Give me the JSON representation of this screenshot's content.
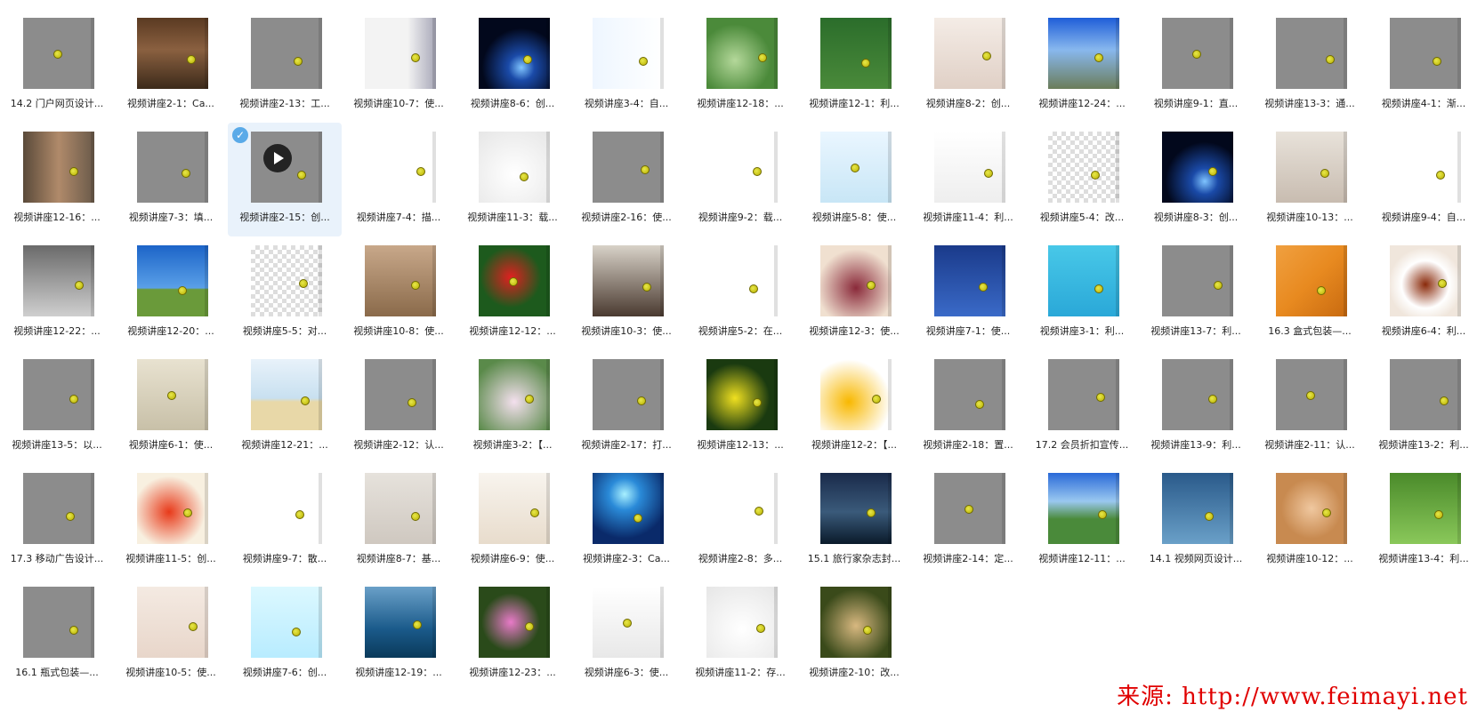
{
  "thumbnails": [
    {
      "label": "14.2 门户网页设计...",
      "bg": "#8c8c8c",
      "icon": "egg-logo-icon"
    },
    {
      "label": "视频讲座2-1：Ca...",
      "bg": "linear-gradient(#5a3a22,#8a6040 45%,#3c2a1a)",
      "icon": "ruined-room-photo-icon"
    },
    {
      "label": "视频讲座2-13：工...",
      "bg": "#8c8c8c",
      "icon": "placeholder-icon"
    },
    {
      "label": "视频讲座10-7：使...",
      "bg": "linear-gradient(90deg,#f3f3f3 60%,#a8a8b8)",
      "icon": "woman-white-shirt-photo-icon"
    },
    {
      "label": "视频讲座8-6：创...",
      "bg": "radial-gradient(circle at 60% 70%,#7fc4ff 0,#1a4aa8 20%,#02081c 60%)",
      "icon": "planet-horizon-photo-icon"
    },
    {
      "label": "视频讲座3-4：自...",
      "bg": "linear-gradient(90deg,#eef6ff,#ffffff)",
      "icon": "cartoon-camel-icon"
    },
    {
      "label": "视频讲座12-18：...",
      "bg": "radial-gradient(circle at 40% 60%,#b4d89a,#4b8a3a 60%)",
      "icon": "leaf-waterdrop-photo-icon"
    },
    {
      "label": "视频讲座12-1：利...",
      "bg": "linear-gradient(#2b6d2b,#4a8a3a)",
      "icon": "tulips-photo-icon"
    },
    {
      "label": "视频讲座8-2：创...",
      "bg": "linear-gradient(#f4ece6,#e0d0c6)",
      "icon": "cat-pillow-photo-icon"
    },
    {
      "label": "视频讲座12-24：...",
      "bg": "linear-gradient(#1f5ed8,#88b8ee 45%,#6b7d5a)",
      "icon": "sky-landscape-photo-icon"
    },
    {
      "label": "视频讲座9-1：直...",
      "bg": "#8c8c8c",
      "icon": "placeholder-icon"
    },
    {
      "label": "视频讲座13-3：通...",
      "bg": "#8c8c8c",
      "icon": "placeholder-icon"
    },
    {
      "label": "视频讲座4-1：渐...",
      "bg": "#8c8c8c",
      "icon": "placeholder-icon"
    },
    {
      "label": "视频讲座12-16：...",
      "bg": "linear-gradient(90deg,#5a4a3a,#b08a6a 50%,#6a5a4a)",
      "icon": "warrior-woman-photo-icon"
    },
    {
      "label": "视频讲座7-3：填...",
      "bg": "#8c8c8c",
      "icon": "placeholder-icon"
    },
    {
      "label": "视频讲座2-15：创...",
      "bg": "#8c8c8c",
      "icon": "video-placeholder-icon"
    },
    {
      "label": "视频讲座7-4：描...",
      "bg": "#ffffff",
      "icon": "dotted-heart-icon"
    },
    {
      "label": "视频讲座11-3：载...",
      "bg": "radial-gradient(circle at 50% 60%,#ffffff,#e6e6e6)",
      "icon": "pepper-fork-photo-icon"
    },
    {
      "label": "视频讲座2-16：使...",
      "bg": "#8c8c8c",
      "icon": "placeholder-icon"
    },
    {
      "label": "视频讲座9-2：载...",
      "bg": "#ffffff",
      "icon": "white-canvas-icon"
    },
    {
      "label": "视频讲座5-8：使...",
      "bg": "linear-gradient(#eaf6ff,#c8e6f6)",
      "icon": "cartoon-frogs-icon"
    },
    {
      "label": "视频讲座11-4：利...",
      "bg": "linear-gradient(#ffffff,#eeeeee)",
      "icon": "handbag-photo-icon"
    },
    {
      "label": "视频讲座5-4：改...",
      "bg": "repeating-conic-gradient(#ddd 0 25%,#fff 0 50%) 0 0/10px 10px",
      "icon": "cartoon-octopus-icon"
    },
    {
      "label": "视频讲座8-3：创...",
      "bg": "radial-gradient(circle at 60% 70%,#7fc4ff 0,#1a4aa8 20%,#02081c 60%)",
      "icon": "planet-horizon-photo-icon"
    },
    {
      "label": "视频讲座10-13：...",
      "bg": "linear-gradient(#e8e2da,#c8bcb0)",
      "icon": "woman-apple-photo-icon"
    },
    {
      "label": "视频讲座9-4：自...",
      "bg": "#ffffff",
      "icon": "black-flower-shape-icon"
    },
    {
      "label": "视频讲座12-22：...",
      "bg": "linear-gradient(#6a6a6a,#cfcfcf)",
      "icon": "eagle-grayscale-photo-icon"
    },
    {
      "label": "视频讲座12-20：...",
      "bg": "linear-gradient(#1c64c8,#5aa0e8 60%,#6a9a3a 62%)",
      "icon": "autumn-tree-photo-icon"
    },
    {
      "label": "视频讲座5-5：对...",
      "bg": "repeating-conic-gradient(#ddd 0 25%,#fff 0 50%) 0 0/10px 10px",
      "icon": "cartoon-octopus-icon"
    },
    {
      "label": "视频讲座10-8：使...",
      "bg": "linear-gradient(#c8a88a,#8a6a4a)",
      "icon": "woman-sofa-photo-icon"
    },
    {
      "label": "视频讲座12-12：...",
      "bg": "radial-gradient(circle at 45% 45%,#e02020,#1d5a1d 55%)",
      "icon": "red-hibiscus-photo-icon"
    },
    {
      "label": "视频讲座10-3：使...",
      "bg": "linear-gradient(#d8d2c8,#4a3a30)",
      "icon": "woman-hat-photo-icon"
    },
    {
      "label": "视频讲座5-2：在...",
      "bg": "#ffffff",
      "icon": "cartoon-characters-icon"
    },
    {
      "label": "视频讲座12-3：使...",
      "bg": "radial-gradient(circle at 50% 60%,#8a2a3a,#f0e0d0 70%)",
      "icon": "coffee-mug-photo-icon"
    },
    {
      "label": "视频讲座7-1：使...",
      "bg": "linear-gradient(#1a3a8a,#3a6ac8)",
      "icon": "teacup-blue-photo-icon"
    },
    {
      "label": "视频讲座3-1：利...",
      "bg": "linear-gradient(#48c8e8,#2aa8d8)",
      "icon": "cartoon-girl-icon"
    },
    {
      "label": "视频讲座13-7：利...",
      "bg": "#8c8c8c",
      "icon": "placeholder-icon"
    },
    {
      "label": "16.3 盒式包装—...",
      "bg": "linear-gradient(135deg,#f0a040,#e88a20 50%,#c86a10)",
      "icon": "pastry-photo-icon"
    },
    {
      "label": "视频讲座6-4：利...",
      "bg": "radial-gradient(circle at 50% 55%,#8a2a0a 0,#ffffff 45%,#f0e6dc 70%)",
      "icon": "tea-cup-photo-icon"
    },
    {
      "label": "视频讲座13-5：以...",
      "bg": "#8c8c8c",
      "icon": "placeholder-icon"
    },
    {
      "label": "视频讲座6-1：使...",
      "bg": "linear-gradient(#e8e2d0,#c8c0a8)",
      "icon": "wall-clock-photo-icon"
    },
    {
      "label": "视频讲座12-21：...",
      "bg": "linear-gradient(#e8f2fa,#c8e0f0 55%,#e8d8a8 60%)",
      "icon": "palm-beach-photo-icon"
    },
    {
      "label": "视频讲座2-12：认...",
      "bg": "#8c8c8c",
      "icon": "placeholder-icon"
    },
    {
      "label": "视频讲座3-2：【...",
      "bg": "radial-gradient(circle at 50% 60%,#f4e0ee,#5a8a4a 80%)",
      "icon": "blossom-flowers-photo-icon"
    },
    {
      "label": "视频讲座2-17：打...",
      "bg": "#8c8c8c",
      "icon": "placeholder-icon"
    },
    {
      "label": "视频讲座12-13：...",
      "bg": "radial-gradient(circle at 40% 55%,#f0e020,#1a3a10 60%)",
      "icon": "dandelion-photo-icon"
    },
    {
      "label": "视频讲座12-2：【...",
      "bg": "radial-gradient(circle at 40% 60%,#f8b800,#ffffff 70%)",
      "icon": "lemons-photo-icon"
    },
    {
      "label": "视频讲座2-18：置...",
      "bg": "#8c8c8c",
      "icon": "placeholder-icon"
    },
    {
      "label": "17.2 会员折扣宣传...",
      "bg": "#8c8c8c",
      "icon": "red-ribbon-banner-icon"
    },
    {
      "label": "视频讲座13-9：利...",
      "bg": "#8c8c8c",
      "icon": "placeholder-icon"
    },
    {
      "label": "视频讲座2-11：认...",
      "bg": "#8c8c8c",
      "icon": "placeholder-icon"
    },
    {
      "label": "视频讲座13-2：利...",
      "bg": "#8c8c8c",
      "icon": "placeholder-icon"
    },
    {
      "label": "17.3 移动广告设计...",
      "bg": "#8c8c8c",
      "icon": "laptop-ad-icon"
    },
    {
      "label": "视频讲座11-5：创...",
      "bg": "radial-gradient(circle at 45% 55%,#e83a1a,#f8f0e0 65%)",
      "icon": "fruit-photo-icon"
    },
    {
      "label": "视频讲座9-7：散...",
      "bg": "#ffffff",
      "icon": "white-canvas-icon"
    },
    {
      "label": "视频讲座8-7：基...",
      "bg": "linear-gradient(#e6e2dc,#cfc8c0)",
      "icon": "chocolate-piece-photo-icon"
    },
    {
      "label": "视频讲座6-9：使...",
      "bg": "linear-gradient(#f8f4ee,#e8dccc)",
      "icon": "woman-smiling-photo-icon"
    },
    {
      "label": "视频讲座2-3：Ca...",
      "bg": "radial-gradient(circle at 45% 30%,#a8f0ff 0,#2a8ad8 25%,#0a2a6a 70%)",
      "icon": "blue-space-photo-icon"
    },
    {
      "label": "视频讲座2-8：多...",
      "bg": "#ffffff",
      "icon": "blue-sketch-woman-icon"
    },
    {
      "label": "15.1 旅行家杂志封...",
      "bg": "linear-gradient(#1a2a4a,#3a5a7a 55%,#0a1a2a)",
      "icon": "night-lake-photo-icon"
    },
    {
      "label": "视频讲座2-14：定...",
      "bg": "#8c8c8c",
      "icon": "placeholder-icon"
    },
    {
      "label": "视频讲座12-11：...",
      "bg": "linear-gradient(#2a6ad8,#9ac8f0 40%,#4a8a3a 65%)",
      "icon": "mountain-meadow-photo-icon"
    },
    {
      "label": "14.1 视频网页设计...",
      "bg": "linear-gradient(#2a5a8a,#6aa0c8)",
      "icon": "fantasy-forest-photo-icon"
    },
    {
      "label": "视频讲座10-12：...",
      "bg": "radial-gradient(circle at 50% 50%,#f0c8a0,#c88a50 60%)",
      "icon": "smiling-woman-photo-icon"
    },
    {
      "label": "视频讲座13-4：利...",
      "bg": "linear-gradient(#4a8a2a,#8ac85a)",
      "icon": "cottage-photo-icon"
    },
    {
      "label": "16.1 瓶式包装—...",
      "bg": "#8c8c8c",
      "icon": "popo-logo-icon"
    },
    {
      "label": "视频讲座10-5：使...",
      "bg": "linear-gradient(#f4eae2,#e8d6ca)",
      "icon": "woman-face-photo-icon"
    },
    {
      "label": "视频讲座7-6：创...",
      "bg": "linear-gradient(#dcf8ff,#b8ecff)",
      "icon": "cartoon-dinosaur-icon"
    },
    {
      "label": "视频讲座12-19：...",
      "bg": "linear-gradient(#6aa0c8,#1a5a8a 60%,#0a3a5a)",
      "icon": "blue-landscape-photo-icon"
    },
    {
      "label": "视频讲座12-23：...",
      "bg": "radial-gradient(circle at 45% 50%,#e87ac8,#2a4a1a 55%)",
      "icon": "thistle-flower-photo-icon"
    },
    {
      "label": "视频讲座6-3：使...",
      "bg": "linear-gradient(#ffffff,#e8e8e8)",
      "icon": "book-photo-icon"
    },
    {
      "label": "视频讲座11-2：存...",
      "bg": "radial-gradient(circle at 50% 60%,#ffffff,#e6e6e6)",
      "icon": "pepper-fork-photo-icon"
    },
    {
      "label": "视频讲座2-10：改...",
      "bg": "radial-gradient(circle at 50% 55%,#d8b880,#3a4a1a 70%)",
      "icon": "puppy-photo-icon"
    }
  ],
  "selected_index": 15,
  "watermark": "来源: http://www.feimayi.net"
}
